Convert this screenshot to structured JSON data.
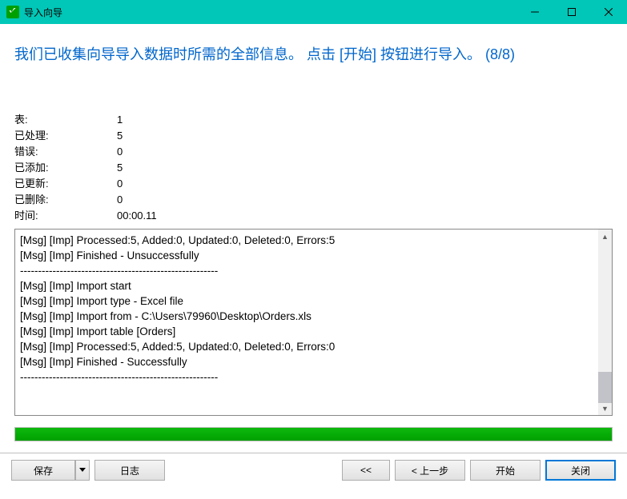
{
  "titlebar": {
    "title": "导入向导"
  },
  "headline": "我们已收集向导导入数据时所需的全部信息。 点击 [开始] 按钮进行导入。  (8/8)",
  "stats": {
    "rows": [
      {
        "label": "表:",
        "value": "1"
      },
      {
        "label": "已处理:",
        "value": "5"
      },
      {
        "label": "错误:",
        "value": "0"
      },
      {
        "label": "已添加:",
        "value": "5"
      },
      {
        "label": "已更新:",
        "value": "0"
      },
      {
        "label": "已删除:",
        "value": "0"
      },
      {
        "label": "时间:",
        "value": "00:00.11"
      }
    ]
  },
  "log": "[Msg] [Imp] Processed:5, Added:0, Updated:0, Deleted:0, Errors:5\n[Msg] [Imp] Finished - Unsuccessfully\n-------------------------------------------------------\n[Msg] [Imp] Import start\n[Msg] [Imp] Import type - Excel file\n[Msg] [Imp] Import from - C:\\Users\\79960\\Desktop\\Orders.xls\n[Msg] [Imp] Import table [Orders]\n[Msg] [Imp] Processed:5, Added:5, Updated:0, Deleted:0, Errors:0\n[Msg] [Imp] Finished - Successfully\n-------------------------------------------------------",
  "progress": {
    "percent": 100
  },
  "footer": {
    "save": "保存",
    "log": "日志",
    "first": "<<",
    "prev": "< 上一步",
    "start": "开始",
    "close": "关闭"
  }
}
